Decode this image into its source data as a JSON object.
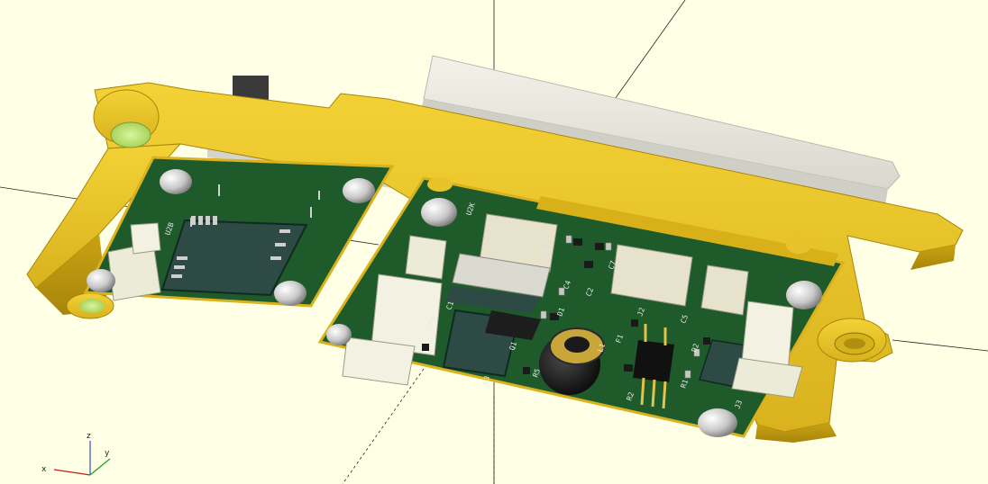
{
  "viewport": {
    "background": "#ffffe5",
    "bracket_color": "#e8c22a",
    "pcb_color": "#1f5a2a",
    "enclosure_color": "#e9e9de"
  },
  "axes_gizmo": {
    "x_label": "x",
    "y_label": "y",
    "z_label": "z"
  },
  "left_board": {
    "silkscreen": [
      "U2B",
      "J1"
    ]
  },
  "right_board": {
    "silkscreen": [
      "U2K",
      "C4",
      "C2",
      "C1",
      "D1",
      "F1",
      "R5",
      "C5",
      "J2",
      "D2",
      "C3",
      "L1",
      "Q1",
      "J3",
      "R1",
      "R2",
      "R3",
      "C6",
      "C7"
    ]
  }
}
